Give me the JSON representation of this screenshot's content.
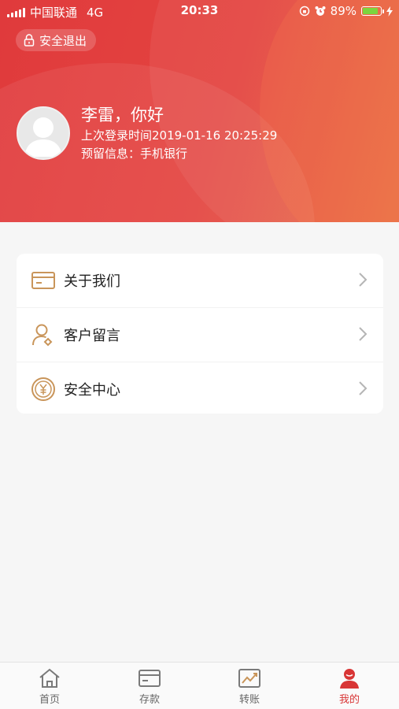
{
  "status_bar": {
    "carrier": "中国联通",
    "network": "4G",
    "time": "20:33",
    "battery": "89%",
    "battery_level": 0.89
  },
  "header": {
    "logout_label": "安全退出",
    "greeting": "李雷，你好",
    "last_login": "上次登录时间2019-01-16 20:25:29",
    "reserved_info": "预留信息：手机银行"
  },
  "menu": {
    "items": [
      {
        "label": "关于我们",
        "icon": "card-icon"
      },
      {
        "label": "客户留言",
        "icon": "user-edit-icon"
      },
      {
        "label": "安全中心",
        "icon": "yen-coin-icon"
      }
    ]
  },
  "tabbar": {
    "tabs": [
      {
        "label": "首页",
        "icon": "home-icon"
      },
      {
        "label": "存款",
        "icon": "card-icon"
      },
      {
        "label": "转账",
        "icon": "chart-icon"
      },
      {
        "label": "我的",
        "icon": "user-icon"
      }
    ],
    "active_index": 3
  },
  "colors": {
    "header_red": "#e03a3c",
    "accent_gold": "#c9955a",
    "tab_active": "#d83535"
  }
}
